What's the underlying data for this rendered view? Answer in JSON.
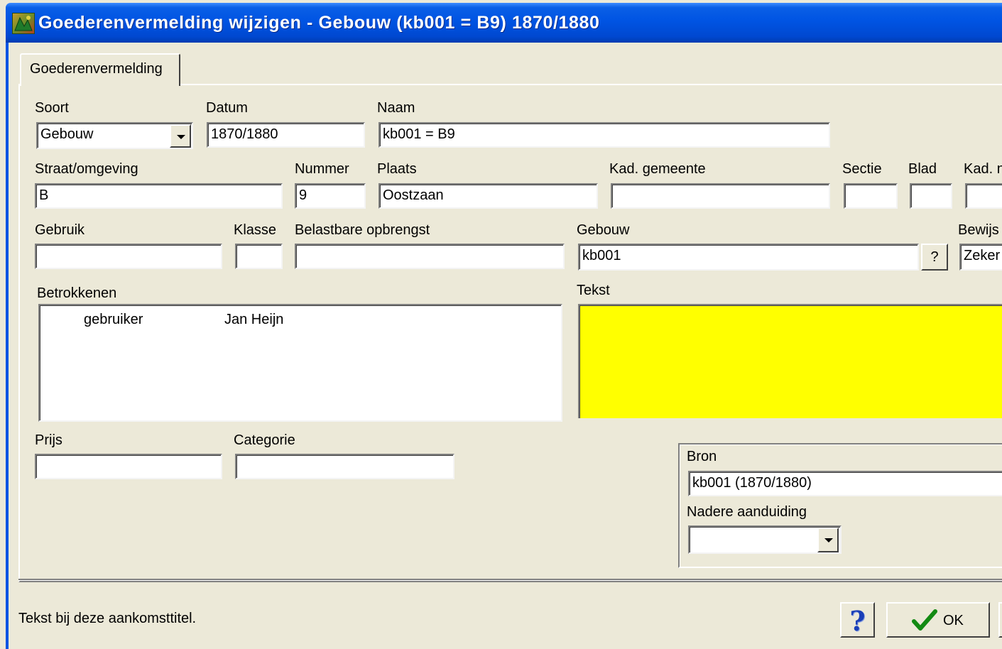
{
  "window": {
    "title": "Goederenvermelding wijzigen - Gebouw (kb001 = B9) 1870/1880",
    "tab_label": "Goederenvermelding"
  },
  "form": {
    "soort": {
      "label": "Soort",
      "value": "Gebouw"
    },
    "datum": {
      "label": "Datum",
      "value": "1870/1880"
    },
    "naam": {
      "label": "Naam",
      "value": "kb001 = B9"
    },
    "straat": {
      "label": "Straat/omgeving",
      "value": "B"
    },
    "nummer": {
      "label": "Nummer",
      "value": "9"
    },
    "plaats": {
      "label": "Plaats",
      "value": "Oostzaan"
    },
    "kad_gemeente": {
      "label": "Kad. gemeente",
      "value": ""
    },
    "sectie": {
      "label": "Sectie",
      "value": ""
    },
    "blad": {
      "label": "Blad",
      "value": ""
    },
    "kad_nr": {
      "label": "Kad. n",
      "value": ""
    },
    "gebruik": {
      "label": "Gebruik",
      "value": ""
    },
    "klasse": {
      "label": "Klasse",
      "value": ""
    },
    "belastbare": {
      "label": "Belastbare opbrengst",
      "value": ""
    },
    "gebouw": {
      "label": "Gebouw",
      "value": "kb001",
      "lookup_label": "?"
    },
    "bewijs": {
      "label": "Bewijs",
      "value": "Zeker"
    },
    "betrokkenen": {
      "label": "Betrokkenen",
      "rows": [
        {
          "role": "gebruiker",
          "name": "Jan Heijn"
        }
      ]
    },
    "tekst": {
      "label": "Tekst",
      "value": "",
      "bg_color": "#ffff00"
    },
    "prijs": {
      "label": "Prijs",
      "value": ""
    },
    "categorie": {
      "label": "Categorie",
      "value": ""
    },
    "bron": {
      "label": "Bron",
      "value": "kb001 (1870/1880)"
    },
    "nadere": {
      "label": "Nadere aanduiding",
      "value": ""
    }
  },
  "statusbar": {
    "hint": "Tekst bij deze aankomsttitel.",
    "help_label": "?",
    "ok_label": "OK"
  },
  "colors": {
    "titlebar": "#0054e3",
    "dialog_bg": "#ece9d8",
    "help_icon": "#1a3fb8",
    "ok_check": "#138a13"
  },
  "icons": [
    "app-icon",
    "dropdown-arrow-icon",
    "help-icon",
    "checkmark-icon"
  ]
}
